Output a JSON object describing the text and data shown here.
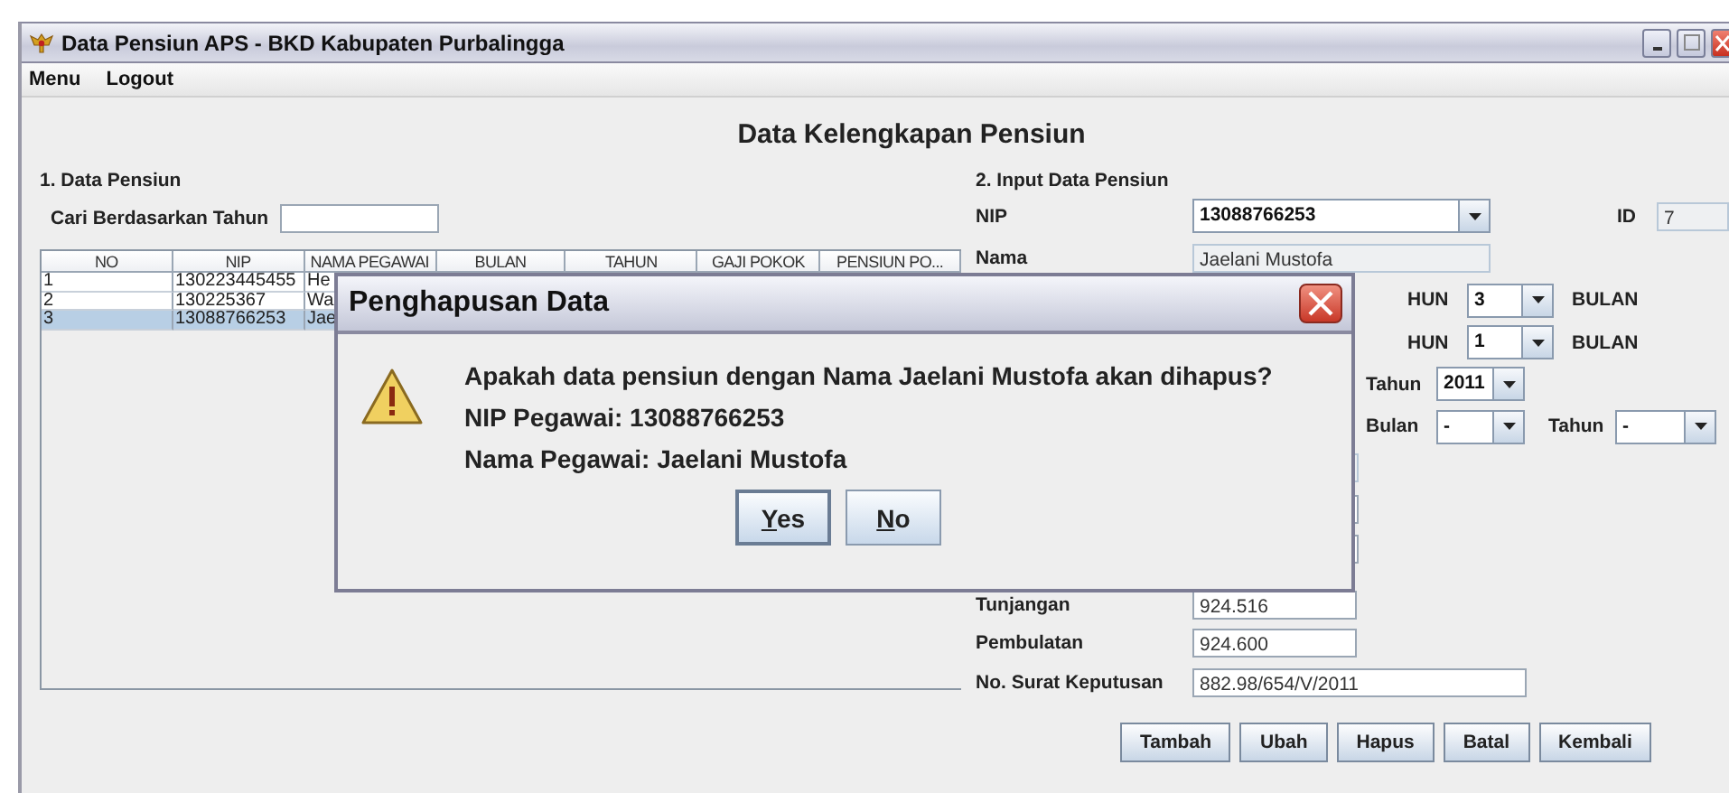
{
  "window": {
    "title": "Data Pensiun APS - BKD Kabupaten Purbalingga"
  },
  "menu": [
    "Menu",
    "Logout"
  ],
  "heading": "Data Kelengkapan Pensiun",
  "left": {
    "title": "1. Data Pensiun",
    "search": {
      "label": "Cari Berdasarkan Tahun"
    },
    "table": {
      "columns": [
        "NO",
        "NIP",
        "NAMA PEGAWAI",
        "BULAN",
        "TAHUN",
        "GAJI POKOK",
        "PENSIUN PO..."
      ],
      "rows": [
        {
          "cells": [
            "1",
            "130223445455",
            "He"
          ],
          "selected": false
        },
        {
          "cells": [
            "2",
            "130225367",
            "Wa"
          ],
          "selected": false
        },
        {
          "cells": [
            "3",
            "13088766253",
            "Jae"
          ],
          "selected": true
        }
      ]
    }
  },
  "form": {
    "title": "2. Input Data Pensiun",
    "nip": {
      "label": "NIP",
      "value": "13088766253"
    },
    "id": {
      "label": "ID",
      "value": "7"
    },
    "nama": {
      "label": "Nama",
      "value": "Jaelani Mustofa"
    },
    "masa": [
      {
        "label_tail": "HUN",
        "value": "3",
        "unit": "BULAN"
      },
      {
        "label_tail": "HUN",
        "value": "1",
        "unit": "BULAN"
      }
    ],
    "row_5": {
      "label": "Tahun",
      "value": "2011"
    },
    "row_6": {
      "bulan_label": "Bulan",
      "bulan_value": "-",
      "tahun_label": "Tahun",
      "tahun_value": "-"
    },
    "hidden_fields": [
      {
        "disabled": true
      },
      {
        "disabled": false
      },
      {
        "disabled": false
      }
    ],
    "tunjangan": {
      "label": "Tunjangan",
      "value": "924.516"
    },
    "pembulatan": {
      "label": "Pembulatan",
      "value": "924.600"
    },
    "no_surat": {
      "label": "No. Surat Keputusan",
      "value": "882.98/654/V/2011"
    },
    "buttons": [
      "Tambah",
      "Ubah",
      "Hapus",
      "Batal",
      "Kembali"
    ]
  },
  "dialog": {
    "title": "Penghapusan Data",
    "lines": [
      "Apakah data pensiun dengan Nama Jaelani Mustofa akan dihapus?",
      "NIP Pegawai: 13088766253",
      "Nama Pegawai: Jaelani Mustofa"
    ],
    "buttons": [
      {
        "label": "Yes",
        "focused": true
      },
      {
        "label": "No",
        "focused": false
      }
    ]
  }
}
